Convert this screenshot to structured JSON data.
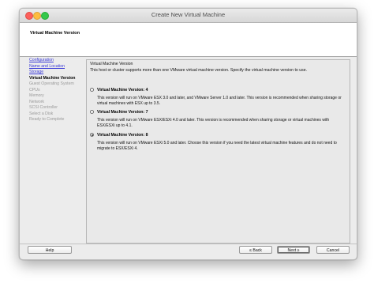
{
  "window": {
    "title": "Create New Virtual Machine"
  },
  "header": {
    "title": "Virtual Machine Version"
  },
  "nav": {
    "items": [
      {
        "label": "Configuration",
        "state": "link"
      },
      {
        "label": "Name and Location",
        "state": "link"
      },
      {
        "label": "Storage",
        "state": "link"
      },
      {
        "label": "Virtual Machine Version",
        "state": "current"
      },
      {
        "label": "Guest Operating System",
        "state": "disabled"
      },
      {
        "label": "CPUs",
        "state": "disabled"
      },
      {
        "label": "Memory",
        "state": "disabled"
      },
      {
        "label": "Network",
        "state": "disabled"
      },
      {
        "label": "SCSI Controller",
        "state": "disabled"
      },
      {
        "label": "Select a Disk",
        "state": "disabled"
      },
      {
        "label": "Ready to Complete",
        "state": "disabled"
      }
    ]
  },
  "content": {
    "legend": "Virtual Machine Version",
    "intro": "This host or cluster supports more than one VMware virtual machine version. Specify the virtual machine version to use.",
    "options": [
      {
        "label": "Virtual Machine Version: 4",
        "checked": false,
        "desc": "This version will run on VMware ESX 3.0 and later, and VMware Server 1.0 and later. This version is recommended when sharing storage or virtual machines with ESX up to 3.5."
      },
      {
        "label": "Virtual Machine Version: 7",
        "checked": false,
        "desc": "This version will run on VMware ESX/ESXi 4.0 and later. This version is recommended when sharing storage or virtual machines with ESX/ESXi up to 4.1."
      },
      {
        "label": "Virtual Machine Version: 8",
        "checked": true,
        "desc": "This version will run on VMware ESXi 5.0 and later. Choose this version if you need the latest virtual machine features and do not need to migrate to ESX/ESXi 4."
      }
    ]
  },
  "buttons": {
    "help": "Help",
    "back": "≤ Back",
    "next": "Next ≥",
    "cancel": "Cancel"
  }
}
